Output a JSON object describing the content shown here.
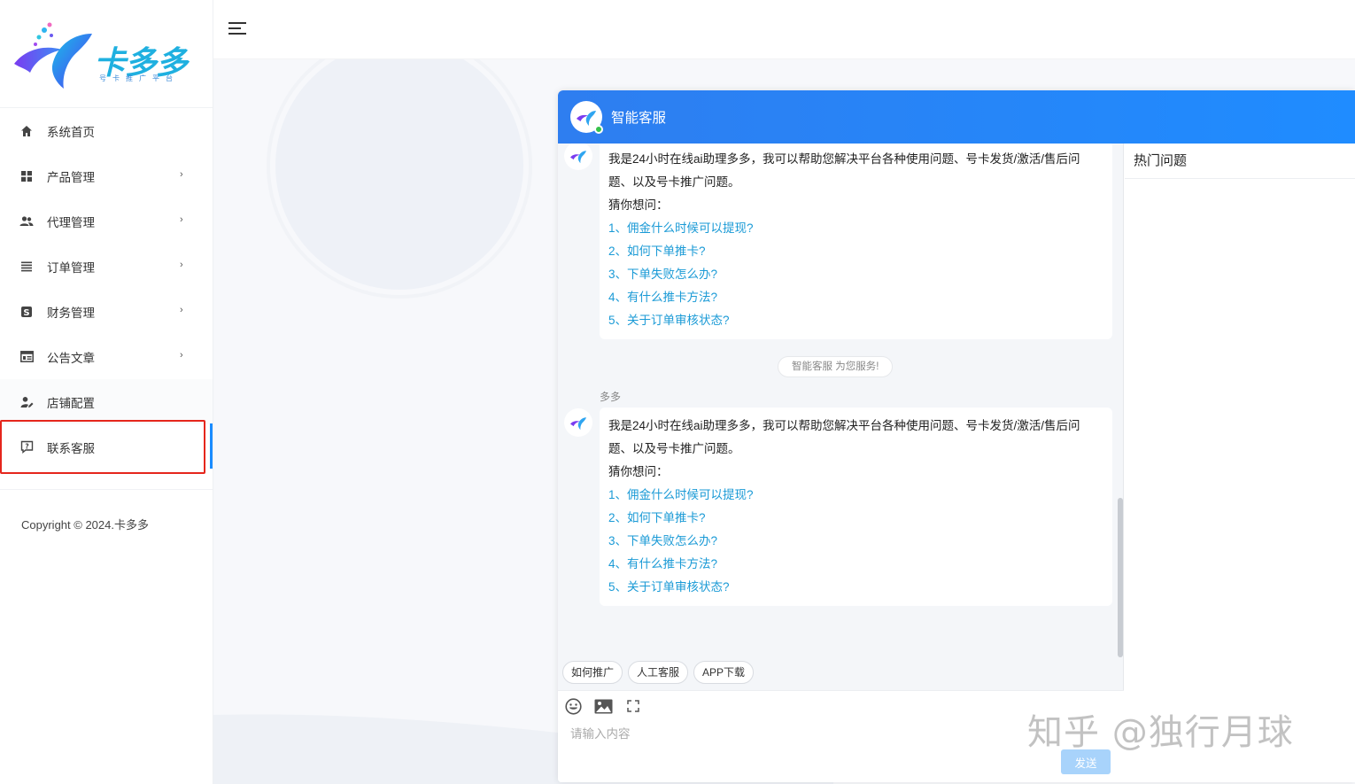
{
  "brand": {
    "name": "卡多多",
    "tagline": "号卡推广平台"
  },
  "sidebar": {
    "items": [
      {
        "label": "系统首页",
        "icon": "home-icon",
        "has_arrow": false
      },
      {
        "label": "产品管理",
        "icon": "grid-icon",
        "has_arrow": true
      },
      {
        "label": "代理管理",
        "icon": "people-icon",
        "has_arrow": true
      },
      {
        "label": "订单管理",
        "icon": "list-icon",
        "has_arrow": true
      },
      {
        "label": "财务管理",
        "icon": "dollar-icon",
        "has_arrow": true
      },
      {
        "label": "公告文章",
        "icon": "article-icon",
        "has_arrow": true
      },
      {
        "label": "店铺配置",
        "icon": "user-edit-icon",
        "has_arrow": false
      },
      {
        "label": "联系客服",
        "icon": "chat-icon",
        "has_arrow": false,
        "active": true
      }
    ],
    "arrow": "›",
    "copyright": "Copyright © 2024.卡多多"
  },
  "chat": {
    "title": "智能客服",
    "accent_color": "#1f8cff",
    "link_color": "#1a9ad6",
    "messages": [
      {
        "intro": "我是24小时在线ai助理多多，我可以帮助您解决平台各种使用问题、号卡发货/激活/售后问题、以及号卡推广问题。",
        "guess": "猜你想问：",
        "questions": [
          "1、佣金什么时候可以提现?",
          "2、如何下单推卡?",
          "3、下单失败怎么办?",
          "4、有什么推卡方法?",
          "5、关于订单审核状态?"
        ]
      },
      {
        "sender": "多多",
        "intro": "我是24小时在线ai助理多多，我可以帮助您解决平台各种使用问题、号卡发货/激活/售后问题、以及号卡推广问题。",
        "guess": "猜你想问：",
        "questions": [
          "1、佣金什么时候可以提现?",
          "2、如何下单推卡?",
          "3、下单失败怎么办?",
          "4、有什么推卡方法?",
          "5、关于订单审核状态?"
        ]
      }
    ],
    "system_tip": "智能客服 为您服务!",
    "quick_replies": [
      "如何推广",
      "人工客服",
      "APP下载"
    ],
    "input_placeholder": "请输入内容",
    "send_label": "发送",
    "hot_title": "热门问题"
  },
  "watermark": "知乎 @独行月球"
}
